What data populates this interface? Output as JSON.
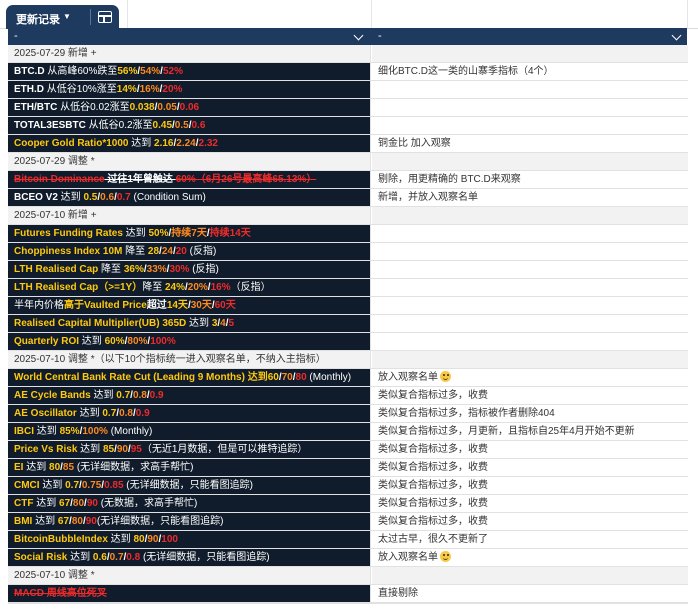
{
  "tab": {
    "label": "更新记录",
    "caret": "▼",
    "icon": "table-icon"
  },
  "filter": {
    "col1": "-",
    "col2": "-",
    "caret": "chevron-down-icon"
  },
  "colors": {
    "header_bg": "#1f3a5f",
    "item_bg": "#101c2b",
    "yellow": "#ffc90e",
    "orange": "#ff8a1e",
    "red": "#ee2b2b"
  },
  "rows": [
    {
      "type": "section",
      "text": "2025-07-29 新增 +",
      "note": ""
    },
    {
      "type": "item",
      "parts": [
        [
          "w",
          "BTC.D"
        ],
        [
          "n",
          " 从高峰60%跌至"
        ],
        [
          "y",
          "56%"
        ],
        [
          "w",
          "/"
        ],
        [
          "o",
          "54%"
        ],
        [
          "w",
          "/"
        ],
        [
          "r",
          "52%"
        ]
      ],
      "note": "细化BTC.D这一类的山寨季指标（4个）"
    },
    {
      "type": "item",
      "parts": [
        [
          "w",
          "ETH.D"
        ],
        [
          "n",
          " 从低谷10%涨至"
        ],
        [
          "y",
          "14%"
        ],
        [
          "w",
          "/"
        ],
        [
          "o",
          "16%"
        ],
        [
          "w",
          "/"
        ],
        [
          "r",
          "20%"
        ]
      ],
      "note": ""
    },
    {
      "type": "item",
      "parts": [
        [
          "w",
          "ETH/BTC"
        ],
        [
          "n",
          " 从低谷0.02涨至"
        ],
        [
          "y",
          "0.038"
        ],
        [
          "w",
          "/"
        ],
        [
          "o",
          "0.05"
        ],
        [
          "w",
          "/"
        ],
        [
          "r",
          "0.06"
        ]
      ],
      "note": ""
    },
    {
      "type": "item",
      "parts": [
        [
          "w",
          "TOTAL3ESBTC"
        ],
        [
          "n",
          " 从低谷0.2涨至"
        ],
        [
          "y",
          "0.45"
        ],
        [
          "w",
          "/"
        ],
        [
          "o",
          "0.5"
        ],
        [
          "w",
          "/"
        ],
        [
          "r",
          "0.6"
        ]
      ],
      "note": ""
    },
    {
      "type": "item",
      "parts": [
        [
          "y",
          "Cooper Gold Ratio*1000"
        ],
        [
          "n",
          " 达到 "
        ],
        [
          "y",
          "2.16"
        ],
        [
          "w",
          "/"
        ],
        [
          "o",
          "2.24"
        ],
        [
          "w",
          "/"
        ],
        [
          "r",
          "2.32"
        ]
      ],
      "note": "铜金比 加入观察"
    },
    {
      "type": "section",
      "text": "2025-07-29 调整 *",
      "note": ""
    },
    {
      "type": "item",
      "parts": [
        [
          "sr",
          "Bitcoin Dominance"
        ],
        [
          "s",
          " 过往1年曾触达 "
        ],
        [
          "sr",
          "60%（6月26号最高峰65.13%）"
        ]
      ],
      "note": "剔除，用更精确的 BTC.D来观察"
    },
    {
      "type": "item",
      "parts": [
        [
          "w",
          "BCEO V2"
        ],
        [
          "n",
          " 达到 "
        ],
        [
          "y",
          "0.5"
        ],
        [
          "w",
          "/"
        ],
        [
          "o",
          "0.6"
        ],
        [
          "w",
          "/"
        ],
        [
          "r",
          "0.7"
        ],
        [
          "n",
          " (Condition Sum)"
        ]
      ],
      "note": "新增，并放入观察名单"
    },
    {
      "type": "section",
      "text": "2025-07-10 新增 +",
      "note": ""
    },
    {
      "type": "item",
      "parts": [
        [
          "y",
          "Futures Funding Rates"
        ],
        [
          "n",
          " 达到 "
        ],
        [
          "y",
          "50%"
        ],
        [
          "w",
          "/"
        ],
        [
          "o",
          "持续7天"
        ],
        [
          "w",
          "/"
        ],
        [
          "r",
          "持续14天"
        ]
      ],
      "note": ""
    },
    {
      "type": "item",
      "parts": [
        [
          "y",
          "Choppiness Index 10M"
        ],
        [
          "n",
          " 降至 "
        ],
        [
          "y",
          "28"
        ],
        [
          "w",
          "/"
        ],
        [
          "o",
          "24"
        ],
        [
          "w",
          "/"
        ],
        [
          "r",
          "20"
        ],
        [
          "n",
          " (反指)"
        ]
      ],
      "note": ""
    },
    {
      "type": "item",
      "parts": [
        [
          "y",
          "LTH Realised Cap"
        ],
        [
          "n",
          " 降至 "
        ],
        [
          "y",
          "36%"
        ],
        [
          "w",
          "/"
        ],
        [
          "o",
          "33%"
        ],
        [
          "w",
          "/"
        ],
        [
          "r",
          "30%"
        ],
        [
          "n",
          "  (反指)"
        ]
      ],
      "note": ""
    },
    {
      "type": "item",
      "parts": [
        [
          "y",
          "LTH Realised Cap（>=1Y）"
        ],
        [
          "n",
          "降至 "
        ],
        [
          "y",
          "24%"
        ],
        [
          "w",
          "/"
        ],
        [
          "o",
          "20%"
        ],
        [
          "w",
          "/"
        ],
        [
          "r",
          "16%"
        ],
        [
          "n",
          "（反指）"
        ]
      ],
      "note": ""
    },
    {
      "type": "item",
      "parts": [
        [
          "n",
          "半年内价格"
        ],
        [
          "y",
          "高于Vaulted Price"
        ],
        [
          "w",
          "超过"
        ],
        [
          "y",
          "14天"
        ],
        [
          "w",
          "/"
        ],
        [
          "o",
          "30天"
        ],
        [
          "w",
          "/"
        ],
        [
          "r",
          "60天"
        ]
      ],
      "note": ""
    },
    {
      "type": "item",
      "parts": [
        [
          "y",
          "Realised Capital Multiplier(UB)  365D"
        ],
        [
          "n",
          " 达到 "
        ],
        [
          "y",
          "3"
        ],
        [
          "w",
          "/"
        ],
        [
          "o",
          "4"
        ],
        [
          "w",
          "/"
        ],
        [
          "r",
          "5"
        ]
      ],
      "note": ""
    },
    {
      "type": "item",
      "parts": [
        [
          "y",
          "Quarterly ROI"
        ],
        [
          "n",
          " 达到 "
        ],
        [
          "y",
          "60%"
        ],
        [
          "w",
          "/"
        ],
        [
          "o",
          "80%"
        ],
        [
          "w",
          "/"
        ],
        [
          "r",
          "100%"
        ]
      ],
      "note": ""
    },
    {
      "type": "section",
      "text": "2025-07-10 调整 *（以下10个指标统一进入观察名单，不纳入主指标）",
      "note": ""
    },
    {
      "type": "item",
      "parts": [
        [
          "y",
          "World Central Bank Rate Cut (Leading 9 Months)"
        ],
        [
          "y",
          " 达到"
        ],
        [
          "y",
          "60"
        ],
        [
          "w",
          "/"
        ],
        [
          "o",
          "70"
        ],
        [
          "w",
          "/"
        ],
        [
          "r",
          "80"
        ],
        [
          "n",
          " (Monthly)"
        ]
      ],
      "note": "放入观察名单",
      "emoji": true
    },
    {
      "type": "item",
      "parts": [
        [
          "y",
          "AE Cycle Bands"
        ],
        [
          "n",
          " 达到 "
        ],
        [
          "y",
          "0.7"
        ],
        [
          "w",
          "/"
        ],
        [
          "o",
          "0.8"
        ],
        [
          "w",
          "/"
        ],
        [
          "r",
          "0.9"
        ]
      ],
      "note": "类似复合指标过多，收费"
    },
    {
      "type": "item",
      "parts": [
        [
          "y",
          "AE Oscillator"
        ],
        [
          "n",
          " 达到 "
        ],
        [
          "y",
          "0.7"
        ],
        [
          "w",
          "/"
        ],
        [
          "o",
          "0.8"
        ],
        [
          "w",
          "/"
        ],
        [
          "r",
          "0.9"
        ]
      ],
      "note": "类似复合指标过多，指标被作者删除404"
    },
    {
      "type": "item",
      "parts": [
        [
          "y",
          "IBCI"
        ],
        [
          "n",
          " 达到 "
        ],
        [
          "y",
          "85%"
        ],
        [
          "w",
          "/"
        ],
        [
          "o",
          "100%"
        ],
        [
          "n",
          " (Monthly)"
        ]
      ],
      "note": "类似复合指标过多，月更新，且指标自25年4月开始不更新"
    },
    {
      "type": "item",
      "parts": [
        [
          "y",
          "Price Vs Risk"
        ],
        [
          "n",
          " 达到 "
        ],
        [
          "y",
          "85"
        ],
        [
          "w",
          "/"
        ],
        [
          "o",
          "90"
        ],
        [
          "w",
          "/"
        ],
        [
          "r",
          "95"
        ],
        [
          "n",
          "（无近1月数据，但是可以推特追踪）"
        ]
      ],
      "note": "类似复合指标过多，收费"
    },
    {
      "type": "item",
      "parts": [
        [
          "y",
          "EI"
        ],
        [
          "n",
          " 达到 "
        ],
        [
          "y",
          "80"
        ],
        [
          "w",
          "/"
        ],
        [
          "o",
          "85"
        ],
        [
          "n",
          " (无详细数据，求高手帮忙)"
        ]
      ],
      "note": "类似复合指标过多，收费"
    },
    {
      "type": "item",
      "parts": [
        [
          "y",
          "CMCI"
        ],
        [
          "n",
          " 达到 "
        ],
        [
          "y",
          "0.7"
        ],
        [
          "w",
          "/"
        ],
        [
          "o",
          "0.75"
        ],
        [
          "w",
          "/"
        ],
        [
          "r",
          "0.85"
        ],
        [
          "n",
          " (无详细数据，只能看图追踪)"
        ]
      ],
      "note": "类似复合指标过多，收费"
    },
    {
      "type": "item",
      "parts": [
        [
          "y",
          "CTF"
        ],
        [
          "n",
          " 达到 "
        ],
        [
          "y",
          "67"
        ],
        [
          "w",
          "/"
        ],
        [
          "o",
          "80"
        ],
        [
          "w",
          "/"
        ],
        [
          "r",
          "90"
        ],
        [
          "n",
          " (无数据，求高手帮忙)"
        ]
      ],
      "note": "类似复合指标过多，收费"
    },
    {
      "type": "item",
      "parts": [
        [
          "y",
          "BMI"
        ],
        [
          "n",
          " 达到 "
        ],
        [
          "y",
          "67"
        ],
        [
          "w",
          "/"
        ],
        [
          "o",
          "80"
        ],
        [
          "w",
          "/"
        ],
        [
          "r",
          "90"
        ],
        [
          "n",
          "(无详细数据，只能看图追踪)"
        ]
      ],
      "note": "类似复合指标过多，收费"
    },
    {
      "type": "item",
      "parts": [
        [
          "y",
          "BitcoinBubbleIndex"
        ],
        [
          "n",
          " 达到 "
        ],
        [
          "y",
          "80"
        ],
        [
          "w",
          "/"
        ],
        [
          "o",
          "90"
        ],
        [
          "w",
          "/"
        ],
        [
          "r",
          "100"
        ]
      ],
      "note": "太过古早，很久不更新了"
    },
    {
      "type": "item",
      "parts": [
        [
          "y",
          "Social Risk"
        ],
        [
          "n",
          " 达到 "
        ],
        [
          "y",
          "0.6"
        ],
        [
          "w",
          "/"
        ],
        [
          "o",
          "0.7"
        ],
        [
          "w",
          "/"
        ],
        [
          "r",
          "0.8"
        ],
        [
          "n",
          " (无详细数据，只能看图追踪)"
        ]
      ],
      "note": "放入观察名单",
      "emoji": true
    },
    {
      "type": "section",
      "text": "2025-07-10 调整 *",
      "note": ""
    },
    {
      "type": "item",
      "parts": [
        [
          "sr",
          "MACD 周线高位死叉"
        ]
      ],
      "note": "直接剔除"
    }
  ]
}
